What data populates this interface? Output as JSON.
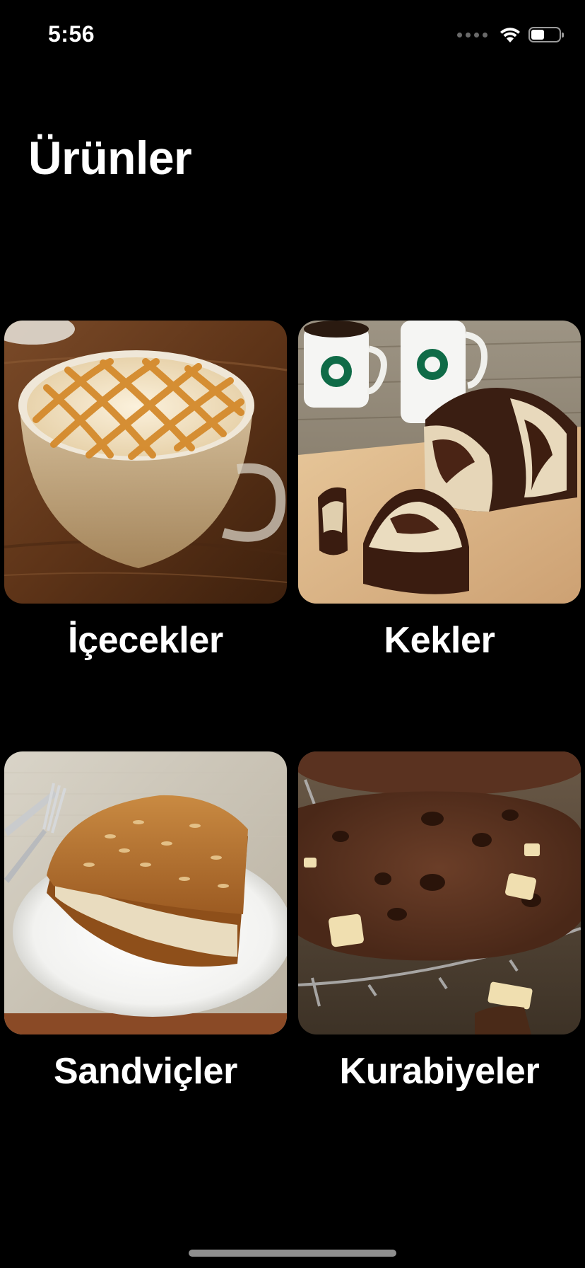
{
  "status_bar": {
    "time": "5:56"
  },
  "header": {
    "title": "Ürünler"
  },
  "categories": [
    {
      "label": "İçecekler",
      "image": "caramel-macchiato-image"
    },
    {
      "label": "Kekler",
      "image": "marble-cake-image"
    },
    {
      "label": "Sandviçler",
      "image": "sandwich-image"
    },
    {
      "label": "Kurabiyeler",
      "image": "chocolate-cookie-image"
    }
  ],
  "colors": {
    "background": "#000000",
    "text": "#ffffff"
  }
}
